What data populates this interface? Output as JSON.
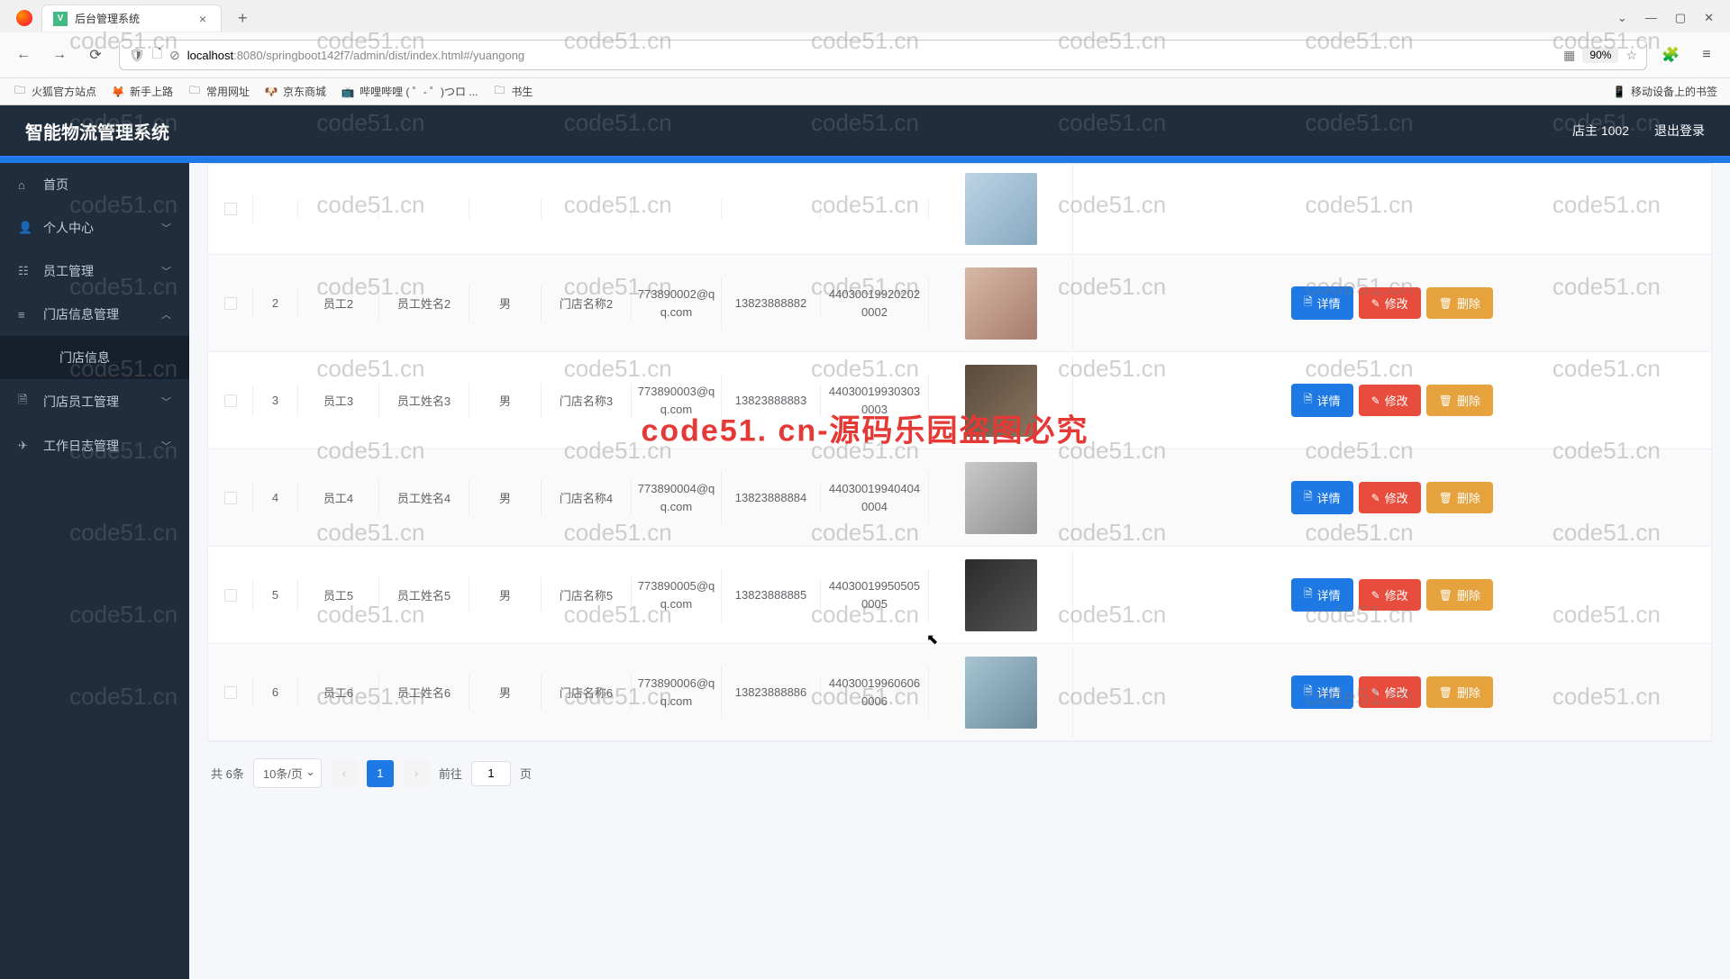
{
  "browser": {
    "tab_title": "后台管理系统",
    "url_host": "localhost",
    "url_rest": ":8080/springboot142f7/admin/dist/index.html#/yuangong",
    "zoom": "90%",
    "bookmarks": [
      "火狐官方站点",
      "新手上路",
      "常用网址",
      "京东商城",
      "哔哩哔哩 ( ゜- ゜)つロ ...",
      "书生"
    ],
    "mobile_bm": "移动设备上的书签"
  },
  "app": {
    "title": "智能物流管理系统",
    "user_label": "店主 1002",
    "logout": "退出登录"
  },
  "menu": [
    {
      "icon": "⌂",
      "label": "首页",
      "arrow": ""
    },
    {
      "icon": "👤",
      "label": "个人中心",
      "arrow": "﹀"
    },
    {
      "icon": "☷",
      "label": "员工管理",
      "arrow": "﹀"
    },
    {
      "icon": "≡",
      "label": "门店信息管理",
      "arrow": "︿"
    },
    {
      "icon": "",
      "label": "门店信息",
      "arrow": "",
      "sub": true
    },
    {
      "icon": "🗎",
      "label": "门店员工管理",
      "arrow": "﹀"
    },
    {
      "icon": "✈",
      "label": "工作日志管理",
      "arrow": "﹀"
    }
  ],
  "actions": {
    "detail": "详情",
    "edit": "修改",
    "delete": "删除"
  },
  "rows": [
    {
      "id": "2",
      "emp": "员工2",
      "name": "员工姓名2",
      "gender": "男",
      "store": "门店名称2",
      "email": "773890002@qq.com",
      "phone": "13823888882",
      "idcard": "440300199202020002",
      "av": "av2"
    },
    {
      "id": "3",
      "emp": "员工3",
      "name": "员工姓名3",
      "gender": "男",
      "store": "门店名称3",
      "email": "773890003@qq.com",
      "phone": "13823888883",
      "idcard": "440300199303030003",
      "av": "av3"
    },
    {
      "id": "4",
      "emp": "员工4",
      "name": "员工姓名4",
      "gender": "男",
      "store": "门店名称4",
      "email": "773890004@qq.com",
      "phone": "13823888884",
      "idcard": "440300199404040004",
      "av": "av4"
    },
    {
      "id": "5",
      "emp": "员工5",
      "name": "员工姓名5",
      "gender": "男",
      "store": "门店名称5",
      "email": "773890005@qq.com",
      "phone": "13823888885",
      "idcard": "440300199505050005",
      "av": "av5"
    },
    {
      "id": "6",
      "emp": "员工6",
      "name": "员工姓名6",
      "gender": "男",
      "store": "门店名称6",
      "email": "773890006@qq.com",
      "phone": "13823888886",
      "idcard": "440300199606060006",
      "av": "av6"
    }
  ],
  "pagination": {
    "total": "共 6条",
    "page_size": "10条/页",
    "current": "1",
    "goto_prefix": "前往",
    "goto_suffix": "页",
    "goto_value": "1"
  },
  "watermark": "code51.cn",
  "watermark_center": "code51. cn-源码乐园盗图必究"
}
